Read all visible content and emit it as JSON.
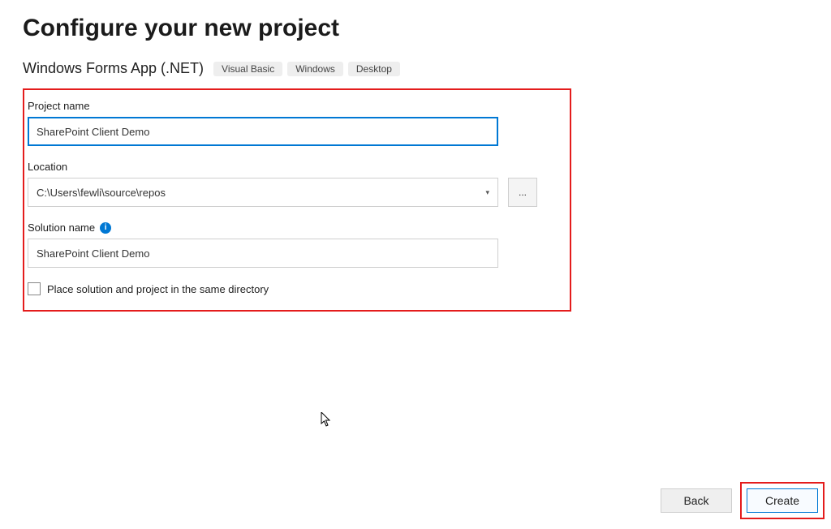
{
  "title": "Configure your new project",
  "subtitle": "Windows Forms App (.NET)",
  "tags": [
    "Visual Basic",
    "Windows",
    "Desktop"
  ],
  "form": {
    "projectName": {
      "label": "Project name",
      "value": "SharePoint Client Demo"
    },
    "location": {
      "label": "Location",
      "value": "C:\\Users\\fewli\\source\\repos",
      "browseLabel": "..."
    },
    "solutionName": {
      "label": "Solution name",
      "value": "SharePoint Client Demo"
    },
    "sameDirectory": {
      "label": "Place solution and project in the same directory",
      "checked": false
    }
  },
  "footer": {
    "backLabel": "Back",
    "createLabel": "Create"
  }
}
